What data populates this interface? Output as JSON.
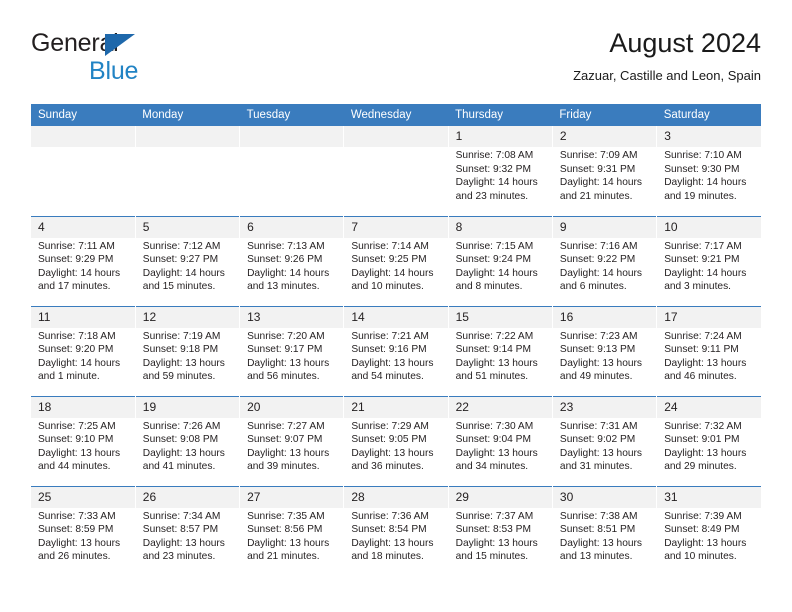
{
  "brand": {
    "name_part1": "General",
    "name_part2": "Blue",
    "triangle_color": "#1e68ab",
    "blue_color": "#2183c4"
  },
  "header": {
    "title": "August 2024",
    "subtitle": "Zazuar, Castille and Leon, Spain"
  },
  "theme": {
    "header_bg": "#3a7cbe",
    "daynum_bg": "#f2f2f2",
    "text": "#231f20"
  },
  "weekday_headers": [
    "Sunday",
    "Monday",
    "Tuesday",
    "Wednesday",
    "Thursday",
    "Friday",
    "Saturday"
  ],
  "weeks": [
    [
      {
        "day": "",
        "empty": true
      },
      {
        "day": "",
        "empty": true
      },
      {
        "day": "",
        "empty": true
      },
      {
        "day": "",
        "empty": true
      },
      {
        "day": "1",
        "sunrise": "Sunrise: 7:08 AM",
        "sunset": "Sunset: 9:32 PM",
        "daylight1": "Daylight: 14 hours",
        "daylight2": "and 23 minutes."
      },
      {
        "day": "2",
        "sunrise": "Sunrise: 7:09 AM",
        "sunset": "Sunset: 9:31 PM",
        "daylight1": "Daylight: 14 hours",
        "daylight2": "and 21 minutes."
      },
      {
        "day": "3",
        "sunrise": "Sunrise: 7:10 AM",
        "sunset": "Sunset: 9:30 PM",
        "daylight1": "Daylight: 14 hours",
        "daylight2": "and 19 minutes."
      }
    ],
    [
      {
        "day": "4",
        "sunrise": "Sunrise: 7:11 AM",
        "sunset": "Sunset: 9:29 PM",
        "daylight1": "Daylight: 14 hours",
        "daylight2": "and 17 minutes."
      },
      {
        "day": "5",
        "sunrise": "Sunrise: 7:12 AM",
        "sunset": "Sunset: 9:27 PM",
        "daylight1": "Daylight: 14 hours",
        "daylight2": "and 15 minutes."
      },
      {
        "day": "6",
        "sunrise": "Sunrise: 7:13 AM",
        "sunset": "Sunset: 9:26 PM",
        "daylight1": "Daylight: 14 hours",
        "daylight2": "and 13 minutes."
      },
      {
        "day": "7",
        "sunrise": "Sunrise: 7:14 AM",
        "sunset": "Sunset: 9:25 PM",
        "daylight1": "Daylight: 14 hours",
        "daylight2": "and 10 minutes."
      },
      {
        "day": "8",
        "sunrise": "Sunrise: 7:15 AM",
        "sunset": "Sunset: 9:24 PM",
        "daylight1": "Daylight: 14 hours",
        "daylight2": "and 8 minutes."
      },
      {
        "day": "9",
        "sunrise": "Sunrise: 7:16 AM",
        "sunset": "Sunset: 9:22 PM",
        "daylight1": "Daylight: 14 hours",
        "daylight2": "and 6 minutes."
      },
      {
        "day": "10",
        "sunrise": "Sunrise: 7:17 AM",
        "sunset": "Sunset: 9:21 PM",
        "daylight1": "Daylight: 14 hours",
        "daylight2": "and 3 minutes."
      }
    ],
    [
      {
        "day": "11",
        "sunrise": "Sunrise: 7:18 AM",
        "sunset": "Sunset: 9:20 PM",
        "daylight1": "Daylight: 14 hours",
        "daylight2": "and 1 minute."
      },
      {
        "day": "12",
        "sunrise": "Sunrise: 7:19 AM",
        "sunset": "Sunset: 9:18 PM",
        "daylight1": "Daylight: 13 hours",
        "daylight2": "and 59 minutes."
      },
      {
        "day": "13",
        "sunrise": "Sunrise: 7:20 AM",
        "sunset": "Sunset: 9:17 PM",
        "daylight1": "Daylight: 13 hours",
        "daylight2": "and 56 minutes."
      },
      {
        "day": "14",
        "sunrise": "Sunrise: 7:21 AM",
        "sunset": "Sunset: 9:16 PM",
        "daylight1": "Daylight: 13 hours",
        "daylight2": "and 54 minutes."
      },
      {
        "day": "15",
        "sunrise": "Sunrise: 7:22 AM",
        "sunset": "Sunset: 9:14 PM",
        "daylight1": "Daylight: 13 hours",
        "daylight2": "and 51 minutes."
      },
      {
        "day": "16",
        "sunrise": "Sunrise: 7:23 AM",
        "sunset": "Sunset: 9:13 PM",
        "daylight1": "Daylight: 13 hours",
        "daylight2": "and 49 minutes."
      },
      {
        "day": "17",
        "sunrise": "Sunrise: 7:24 AM",
        "sunset": "Sunset: 9:11 PM",
        "daylight1": "Daylight: 13 hours",
        "daylight2": "and 46 minutes."
      }
    ],
    [
      {
        "day": "18",
        "sunrise": "Sunrise: 7:25 AM",
        "sunset": "Sunset: 9:10 PM",
        "daylight1": "Daylight: 13 hours",
        "daylight2": "and 44 minutes."
      },
      {
        "day": "19",
        "sunrise": "Sunrise: 7:26 AM",
        "sunset": "Sunset: 9:08 PM",
        "daylight1": "Daylight: 13 hours",
        "daylight2": "and 41 minutes."
      },
      {
        "day": "20",
        "sunrise": "Sunrise: 7:27 AM",
        "sunset": "Sunset: 9:07 PM",
        "daylight1": "Daylight: 13 hours",
        "daylight2": "and 39 minutes."
      },
      {
        "day": "21",
        "sunrise": "Sunrise: 7:29 AM",
        "sunset": "Sunset: 9:05 PM",
        "daylight1": "Daylight: 13 hours",
        "daylight2": "and 36 minutes."
      },
      {
        "day": "22",
        "sunrise": "Sunrise: 7:30 AM",
        "sunset": "Sunset: 9:04 PM",
        "daylight1": "Daylight: 13 hours",
        "daylight2": "and 34 minutes."
      },
      {
        "day": "23",
        "sunrise": "Sunrise: 7:31 AM",
        "sunset": "Sunset: 9:02 PM",
        "daylight1": "Daylight: 13 hours",
        "daylight2": "and 31 minutes."
      },
      {
        "day": "24",
        "sunrise": "Sunrise: 7:32 AM",
        "sunset": "Sunset: 9:01 PM",
        "daylight1": "Daylight: 13 hours",
        "daylight2": "and 29 minutes."
      }
    ],
    [
      {
        "day": "25",
        "sunrise": "Sunrise: 7:33 AM",
        "sunset": "Sunset: 8:59 PM",
        "daylight1": "Daylight: 13 hours",
        "daylight2": "and 26 minutes."
      },
      {
        "day": "26",
        "sunrise": "Sunrise: 7:34 AM",
        "sunset": "Sunset: 8:57 PM",
        "daylight1": "Daylight: 13 hours",
        "daylight2": "and 23 minutes."
      },
      {
        "day": "27",
        "sunrise": "Sunrise: 7:35 AM",
        "sunset": "Sunset: 8:56 PM",
        "daylight1": "Daylight: 13 hours",
        "daylight2": "and 21 minutes."
      },
      {
        "day": "28",
        "sunrise": "Sunrise: 7:36 AM",
        "sunset": "Sunset: 8:54 PM",
        "daylight1": "Daylight: 13 hours",
        "daylight2": "and 18 minutes."
      },
      {
        "day": "29",
        "sunrise": "Sunrise: 7:37 AM",
        "sunset": "Sunset: 8:53 PM",
        "daylight1": "Daylight: 13 hours",
        "daylight2": "and 15 minutes."
      },
      {
        "day": "30",
        "sunrise": "Sunrise: 7:38 AM",
        "sunset": "Sunset: 8:51 PM",
        "daylight1": "Daylight: 13 hours",
        "daylight2": "and 13 minutes."
      },
      {
        "day": "31",
        "sunrise": "Sunrise: 7:39 AM",
        "sunset": "Sunset: 8:49 PM",
        "daylight1": "Daylight: 13 hours",
        "daylight2": "and 10 minutes."
      }
    ]
  ]
}
